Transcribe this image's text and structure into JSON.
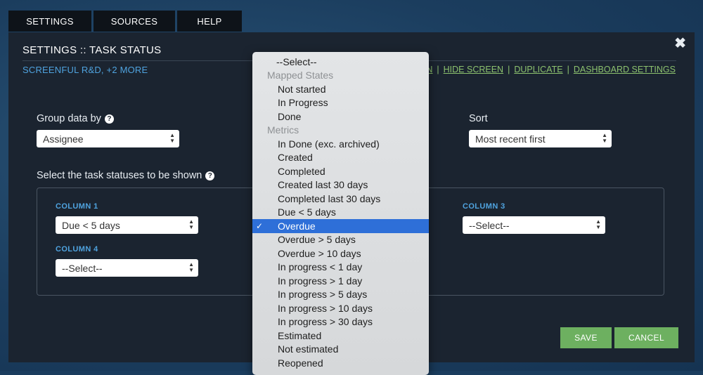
{
  "tabs": [
    {
      "label": "SETTINGS"
    },
    {
      "label": "SOURCES"
    },
    {
      "label": "HELP"
    }
  ],
  "panel": {
    "title": "SETTINGS :: TASK STATUS",
    "workspace_link": "SCREENFUL R&D, +2 MORE",
    "actions": {
      "truncated_link": "EEN",
      "hide_screen": "HIDE SCREEN",
      "duplicate": "DUPLICATE",
      "dashboard_settings": "DASHBOARD SETTINGS",
      "separator": "|"
    },
    "group_by": {
      "label": "Group data by",
      "value": "Assignee"
    },
    "sort": {
      "label": "Sort",
      "value": "Most recent first"
    },
    "statuses_label": "Select the task statuses to be shown",
    "columns": [
      {
        "label": "COLUMN 1",
        "value": "Due < 5 days"
      },
      {
        "label": "COLUMN 3",
        "value": "--Select--"
      },
      {
        "label": "COLUMN 4",
        "value": "--Select--"
      }
    ],
    "save": "SAVE",
    "cancel": "CANCEL"
  },
  "dropdown": {
    "placeholder": "--Select--",
    "groups": [
      {
        "label": "Mapped States",
        "options": [
          "Not started",
          "In Progress",
          "Done"
        ]
      },
      {
        "label": "Metrics",
        "options": [
          "In Done (exc. archived)",
          "Created",
          "Completed",
          "Created last 30 days",
          "Completed last 30 days",
          "Due < 5 days",
          "Overdue",
          "Overdue > 5 days",
          "Overdue > 10 days",
          "In progress < 1 day",
          "In progress > 1 day",
          "In progress > 5 days",
          "In progress > 10 days",
          "In progress > 30 days",
          "Estimated",
          "Not estimated",
          "Reopened"
        ]
      }
    ],
    "selected": "Overdue",
    "check_glyph": "✓"
  },
  "colors": {
    "accent_blue": "#4fa3df",
    "link_green": "#8cc16e",
    "button_green": "#6db060",
    "selected_blue": "#2e6fd8"
  }
}
